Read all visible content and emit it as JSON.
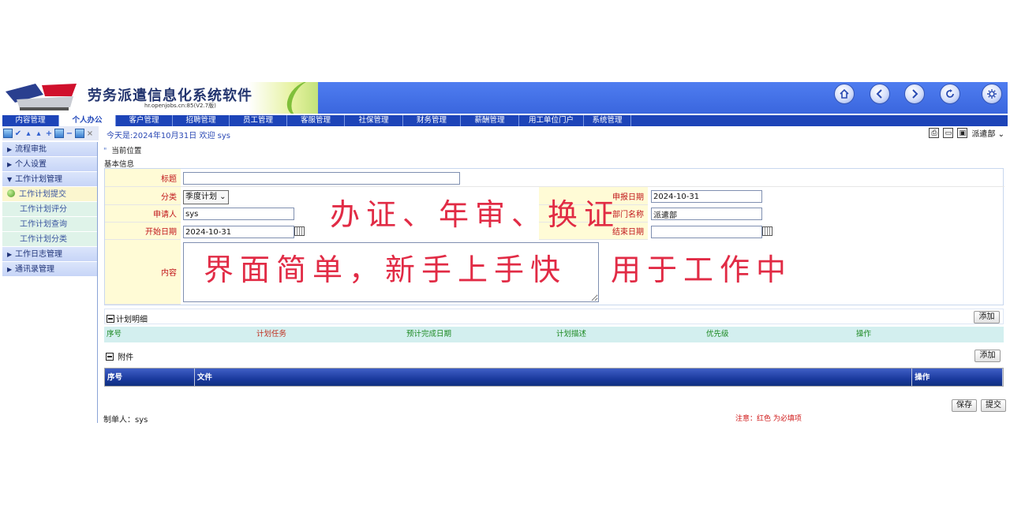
{
  "header": {
    "title": "劳务派遣信息化系统软件",
    "subtitle": "hr.openjobs.cn:85(V2.7版)",
    "buttons": [
      "home-icon",
      "back-icon",
      "forward-icon",
      "refresh-icon",
      "settings-icon"
    ],
    "colors": {
      "bar": "#3a66de",
      "nav": "#1d44b8",
      "accent": "#e0203c"
    }
  },
  "nav": [
    {
      "label": "内容管理",
      "w": 72
    },
    {
      "label": "个人办公",
      "w": 72,
      "active": true
    },
    {
      "label": "客户管理",
      "w": 72
    },
    {
      "label": "招聘管理",
      "w": 72
    },
    {
      "label": "员工管理",
      "w": 73
    },
    {
      "label": "客服管理",
      "w": 73
    },
    {
      "label": "社保管理",
      "w": 74
    },
    {
      "label": "财务管理",
      "w": 73
    },
    {
      "label": "薪酬管理",
      "w": 74
    },
    {
      "label": "用工单位门户",
      "w": 82
    },
    {
      "label": "系统管理",
      "w": 60
    }
  ],
  "toolbar": {
    "welcome": "今天是:2024年10月31日 欢迎 sys",
    "department": "派遣部"
  },
  "sidebar": {
    "items": [
      {
        "label": "流程审批",
        "type": "group",
        "expanded": false
      },
      {
        "label": "个人设置",
        "type": "group",
        "expanded": false
      },
      {
        "label": "工作计划管理",
        "type": "group",
        "expanded": true
      },
      {
        "label": "工作计划提交",
        "type": "sub",
        "active": true
      },
      {
        "label": "工作计划评分",
        "type": "sub"
      },
      {
        "label": "工作计划查询",
        "type": "sub"
      },
      {
        "label": "工作计划分类",
        "type": "sub"
      },
      {
        "label": "工作日志管理",
        "type": "group",
        "expanded": false
      },
      {
        "label": "通讯录管理",
        "type": "group",
        "expanded": false
      }
    ]
  },
  "main": {
    "breadcrumb": "当前位置",
    "basic_info": "基本信息",
    "form": {
      "title_label": "标题",
      "title_value": "",
      "category_label": "分类",
      "category_value": "季度计划",
      "applicant_label": "申请人",
      "applicant_value": "sys",
      "start_label": "开始日期",
      "start_value": "2024-10-31",
      "report_date_label": "申报日期",
      "report_date_value": "2024-10-31",
      "dept_label": "部门名称",
      "dept_value": "派遣部",
      "end_label": "结束日期",
      "end_value": "",
      "content_label": "内容",
      "content_value": ""
    },
    "plan_detail": {
      "title": "计划明细",
      "add_label": "添加",
      "columns": [
        "序号",
        "计划任务",
        "预计完成日期",
        "计划描述",
        "优先级",
        "操作"
      ]
    },
    "attachment": {
      "title": "附件",
      "add_label": "添加",
      "columns": [
        "序号",
        "文件",
        "操作"
      ]
    },
    "footer": {
      "maker": "制单人：sys",
      "note": "注意：红色 为必填项",
      "save_label": "保存",
      "submit_label": "提交"
    }
  },
  "overlay": {
    "line1": "办证、年审、换证",
    "line2": "界面简单，新手上手快",
    "line3": "用于工作中"
  }
}
